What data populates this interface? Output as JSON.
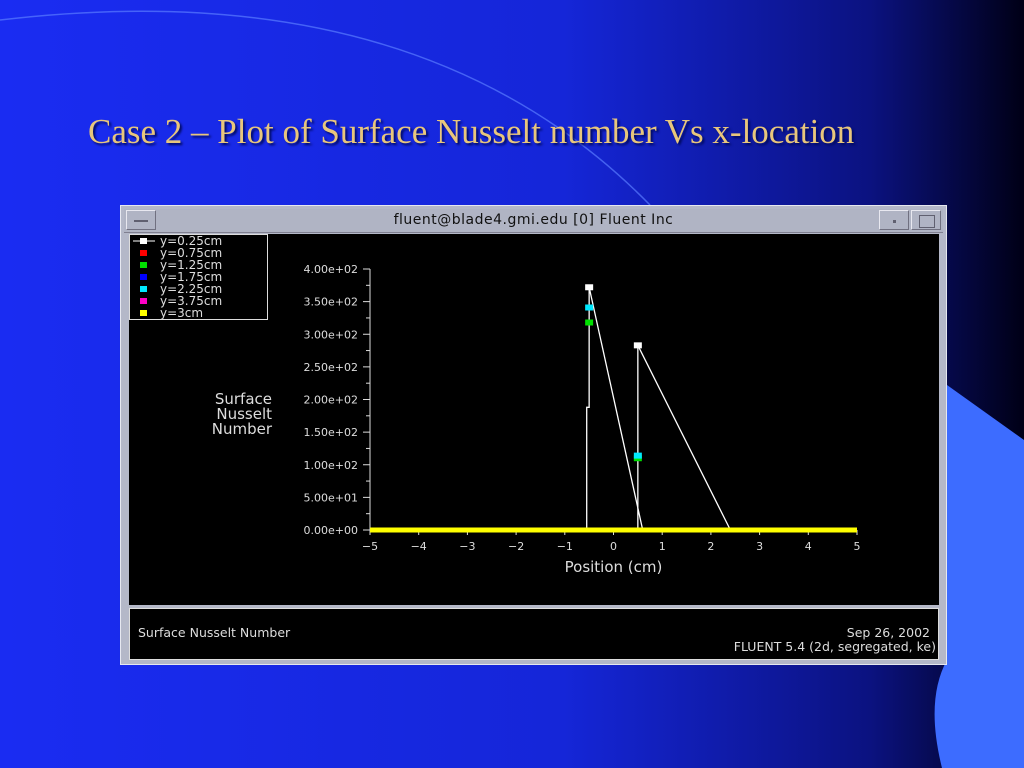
{
  "slide": {
    "title": "Case 2 – Plot of Surface Nusselt number Vs x-location"
  },
  "window": {
    "title": "fluent@blade4.gmi.edu [0] Fluent Inc"
  },
  "footer": {
    "left": "Surface  Nusselt  Number",
    "date": "Sep  26,  2002",
    "version": "FLUENT  5.4  (2d,  segregated,  ke)"
  },
  "chart_data": {
    "type": "line",
    "title": "",
    "xlabel": "Position  (cm)",
    "ylabel": [
      "Surface",
      "Nusselt",
      "Number"
    ],
    "xlim": [
      -5,
      5
    ],
    "ylim": [
      0,
      400
    ],
    "xticks": [
      -5,
      -4,
      -3,
      -2,
      -1,
      0,
      1,
      2,
      3,
      4,
      5
    ],
    "yticks": [
      "0.00e+00",
      "5.00e+01",
      "1.00e+02",
      "1.50e+02",
      "2.00e+02",
      "2.50e+02",
      "3.00e+02",
      "3.50e+02",
      "4.00e+02"
    ],
    "ytick_values": [
      0,
      50,
      100,
      150,
      200,
      250,
      300,
      350,
      400
    ],
    "legend_position": "top-left",
    "series": [
      {
        "name": "y=0.25cm",
        "color": "#ffffff",
        "lines": [
          [
            [
              -0.55,
              0
            ],
            [
              -0.55,
              188
            ],
            [
              -0.5,
              188
            ],
            [
              -0.5,
              372
            ],
            [
              0.6,
              0
            ]
          ],
          [
            [
              0.5,
              0
            ],
            [
              0.5,
              283
            ],
            [
              2.4,
              0
            ]
          ]
        ],
        "markers": [
          [
            -0.5,
            372
          ],
          [
            0.5,
            283
          ]
        ]
      },
      {
        "name": "y=0.75cm",
        "color": "#ff0000",
        "lines": [],
        "markers": []
      },
      {
        "name": "y=1.25cm",
        "color": "#00e000",
        "lines": [],
        "markers": [
          [
            -0.5,
            318
          ],
          [
            0.5,
            110
          ]
        ]
      },
      {
        "name": "y=1.75cm",
        "color": "#0000ff",
        "lines": [],
        "markers": []
      },
      {
        "name": "y=2.25cm",
        "color": "#00e8ff",
        "lines": [],
        "markers": [
          [
            -0.5,
            341
          ],
          [
            0.5,
            114
          ]
        ]
      },
      {
        "name": "y=3.75cm",
        "color": "#ff00c8",
        "lines": [],
        "markers": []
      },
      {
        "name": "y=3cm",
        "color": "#ffff00",
        "lines": [
          [
            [
              -5,
              0
            ],
            [
              5,
              0
            ]
          ]
        ],
        "markers": []
      }
    ]
  }
}
